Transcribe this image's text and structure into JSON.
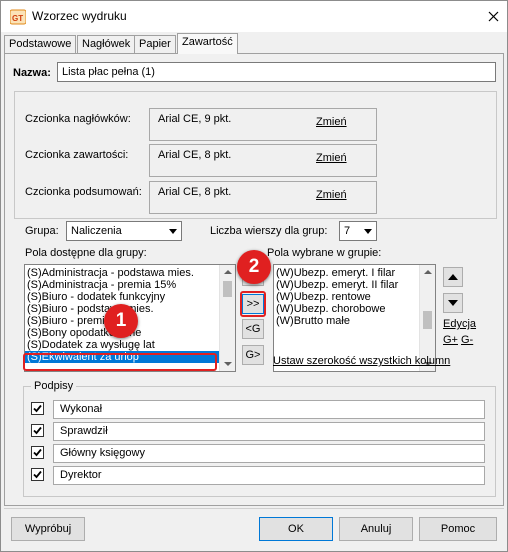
{
  "window": {
    "title": "Wzorzec wydruku",
    "accent_color": "#0078d7",
    "annotation_color": "#e02020"
  },
  "tabs": [
    {
      "label": "Podstawowe",
      "active": false
    },
    {
      "label": "Nagłówek",
      "active": false
    },
    {
      "label": "Papier",
      "active": false
    },
    {
      "label": "Zawartość",
      "active": true
    }
  ],
  "name_field": {
    "label": "Nazwa:",
    "value": "Lista płac pełna (1)"
  },
  "fonts": {
    "change_label": "Zmień",
    "items": [
      {
        "label": "Czcionka nagłówków:",
        "value": "Arial CE, 9 pkt."
      },
      {
        "label": "Czcionka zawartości:",
        "value": "Arial CE, 8 pkt."
      },
      {
        "label": "Czcionka podsumowań:",
        "value": "Arial CE, 8 pkt."
      }
    ]
  },
  "group": {
    "label": "Grupa:",
    "value": "Naliczenia"
  },
  "rows_per_group": {
    "label": "Liczba wierszy dla grup:",
    "value": "7"
  },
  "available": {
    "label": "Pola dostępne dla grupy:",
    "items": [
      "(S)Administracja - podstawa mies.",
      "(S)Administracja - premia 15%",
      "(S)Biuro - dodatek funkcyjny",
      "(S)Biuro - podstawa mies.",
      "(S)Biuro - premia 15%",
      "(S)Bony opodatkowane",
      "(S)Dodatek za wysługę lat",
      "(S)Ekwiwalent za urlop"
    ],
    "selected_index": 7
  },
  "transfer_buttons": {
    "add": ">>",
    "remove": "<G",
    "add_group": "G>"
  },
  "selected": {
    "label": "Pola wybrane w grupie:",
    "items": [
      "(W)Ubezp. emeryt. I filar",
      "(W)Ubezp. emeryt. II filar",
      "(W)Ubezp. rentowe",
      "(W)Ubezp. chorobowe",
      "(W)Brutto małe"
    ]
  },
  "side_links": {
    "edit": "Edycja",
    "g_plus": "G+",
    "g_minus": "G-"
  },
  "set_width_link": "Ustaw szerokość wszystkich kolumn",
  "signatures": {
    "title": "Podpisy",
    "items": [
      {
        "checked": true,
        "value": "Wykonał"
      },
      {
        "checked": true,
        "value": "Sprawdził"
      },
      {
        "checked": true,
        "value": "Główny księgowy"
      },
      {
        "checked": true,
        "value": "Dyrektor"
      }
    ]
  },
  "footer": {
    "test": "Wypróbuj",
    "ok": "OK",
    "cancel": "Anuluj",
    "help": "Pomoc"
  },
  "annotations": {
    "one": "1",
    "two": "2"
  }
}
